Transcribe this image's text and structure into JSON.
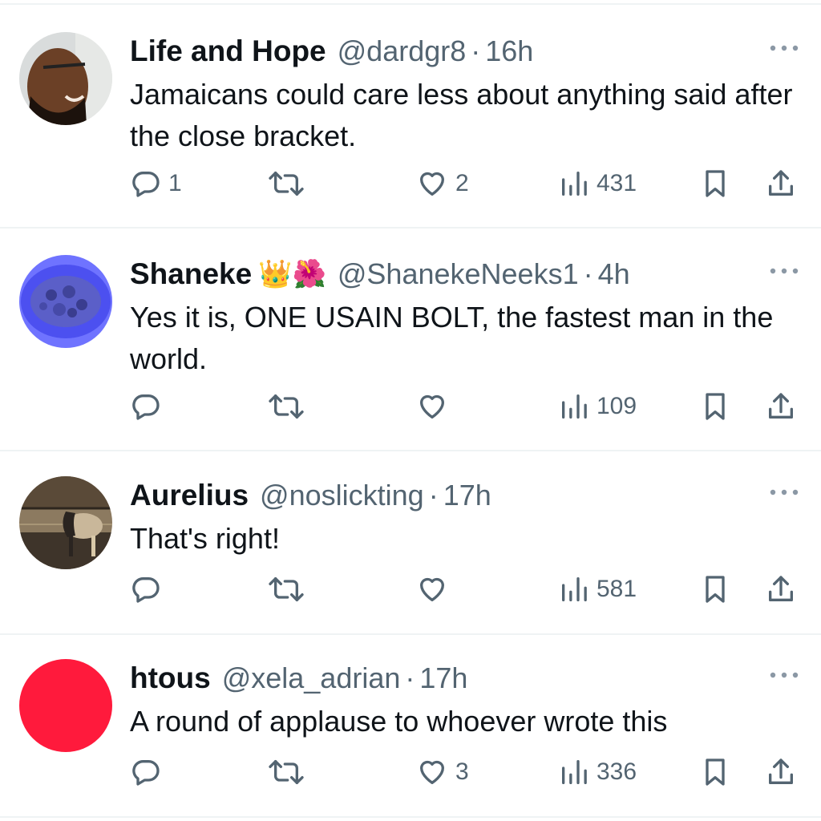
{
  "tweets": [
    {
      "name": "Life and Hope",
      "emojis": "",
      "handle": "@dardgr8",
      "separator": "·",
      "time": "16h",
      "text": "Jamaicans could care less about anything said after the close bracket.",
      "replies": "1",
      "retweets": "",
      "likes": "2",
      "views": "431",
      "avatar_color": "#8a5a3c"
    },
    {
      "name": "Shaneke",
      "emojis": "👑🌺",
      "handle": "@ShanekeNeeks1",
      "separator": "·",
      "time": "4h",
      "text": "Yes it is, ONE USAIN BOLT, the fastest man in the world.",
      "replies": "",
      "retweets": "",
      "likes": "",
      "views": "109",
      "avatar_color": "#4a4ce8"
    },
    {
      "name": "Aurelius",
      "emojis": "",
      "handle": "@noslickting",
      "separator": "·",
      "time": "17h",
      "text": "That's right!",
      "replies": "",
      "retweets": "",
      "likes": "",
      "views": "581",
      "avatar_color": "#6b5a45"
    },
    {
      "name": "htous",
      "emojis": "",
      "handle": "@xela_adrian",
      "separator": "·",
      "time": "17h",
      "text": "A round of applause to whoever wrote this",
      "replies": "",
      "retweets": "",
      "likes": "3",
      "views": "336",
      "avatar_color": "#ff1a3c"
    }
  ],
  "icons": {
    "reply": "reply-icon",
    "retweet": "retweet-icon",
    "like": "like-icon",
    "views": "views-icon",
    "bookmark": "bookmark-icon",
    "share": "share-icon",
    "more": "more-icon"
  },
  "colors": {
    "icon_gray": "#536471",
    "text": "#0f1419",
    "divider": "#eff3f4"
  }
}
